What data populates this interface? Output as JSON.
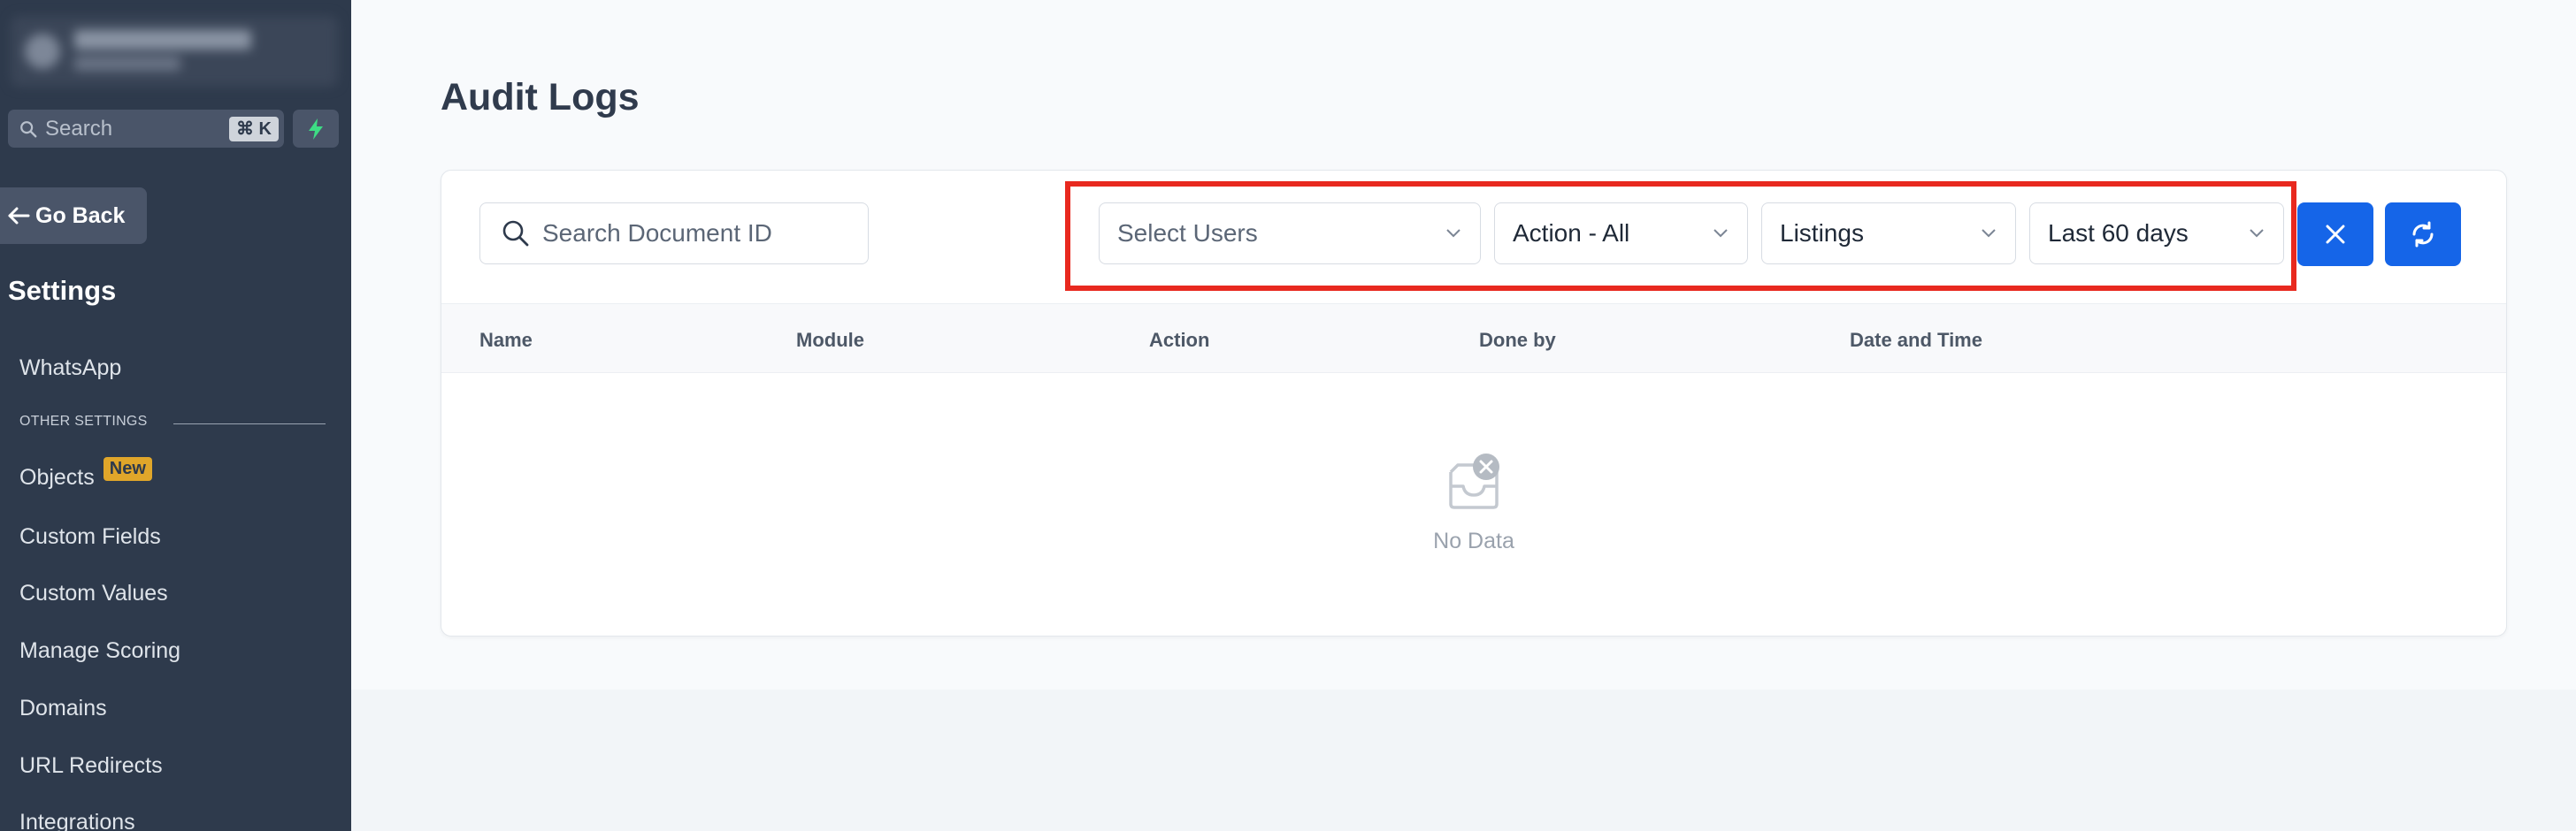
{
  "sidebar": {
    "search": {
      "placeholder": "Search",
      "shortcut": "⌘ K"
    },
    "go_back": "Go Back",
    "section_title": "Settings",
    "items_top": [
      {
        "label": "WhatsApp"
      }
    ],
    "other_settings_label": "OTHER SETTINGS",
    "items": [
      {
        "label": "Objects",
        "badge": "New"
      },
      {
        "label": "Custom Fields"
      },
      {
        "label": "Custom Values"
      },
      {
        "label": "Manage Scoring"
      },
      {
        "label": "Domains"
      },
      {
        "label": "URL Redirects"
      },
      {
        "label": "Integrations"
      }
    ]
  },
  "main": {
    "title": "Audit Logs",
    "search_document": {
      "placeholder": "Search Document ID",
      "value": ""
    },
    "filters": {
      "users": "Select Users",
      "action": "Action - All",
      "module": "Listings",
      "date_range": "Last 60 days"
    },
    "table": {
      "columns": [
        "Name",
        "Module",
        "Action",
        "Done by",
        "Date and Time"
      ]
    },
    "empty_text": "No Data"
  },
  "colors": {
    "sidebar_bg": "#2e3a4c",
    "accent": "#1565e8",
    "highlight": "#e8291f",
    "badge": "#e0a62a",
    "bolt": "#3ddc84"
  }
}
